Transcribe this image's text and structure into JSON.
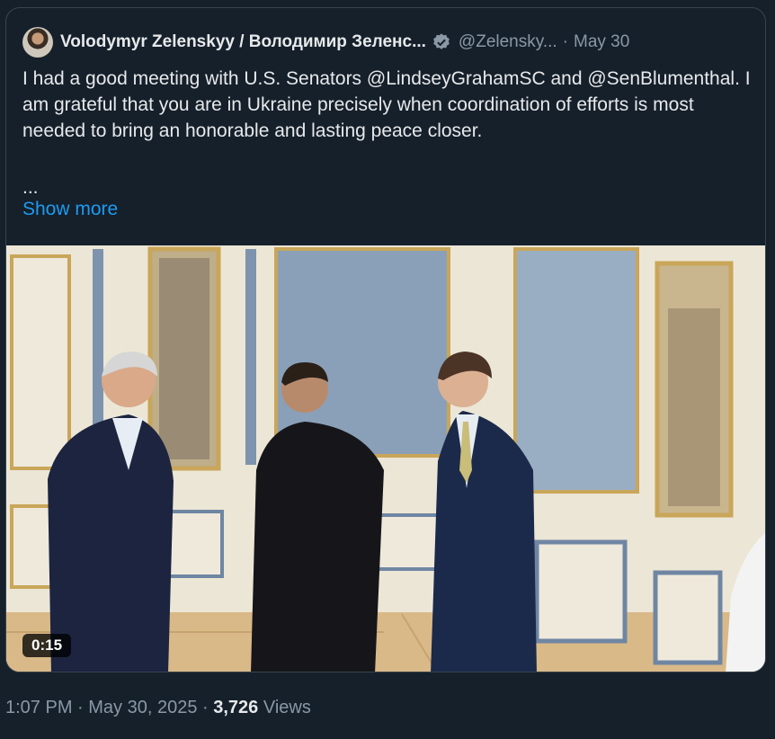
{
  "post": {
    "display_name": "Volodymyr Zelenskyy / Володимир Зеленс...",
    "handle": "@Zelensky...",
    "separator": "·",
    "date": "May 30",
    "text": "I had a good meeting with U.S. Senators @LindseyGrahamSC and @SenBlumenthal. I am grateful that you are in Ukraine precisely when coordination of efforts is most needed to bring an honorable and lasting peace closer.",
    "ellipsis": "...",
    "show_more": "Show more",
    "video_duration": "0:15"
  },
  "footer": {
    "timestamp": "1:07 PM · May 30, 2025 · ",
    "views_count": "3,726",
    "views_label": " Views"
  },
  "colors": {
    "background": "#15202b",
    "link": "#1d9bf0",
    "muted": "#8b98a5",
    "verified": "#8b98a5"
  },
  "icons": {
    "verified": "verified-badge-icon",
    "avatar": "user-avatar"
  }
}
